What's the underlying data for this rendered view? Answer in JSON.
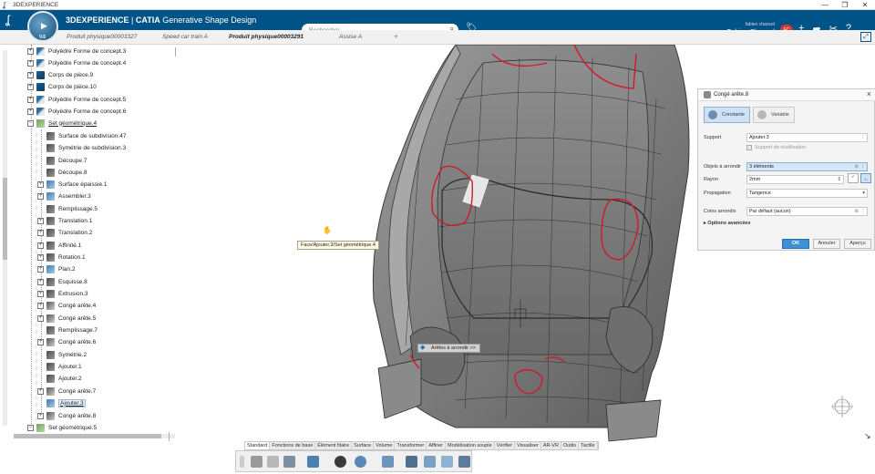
{
  "window": {
    "title": "3DEXPERIENCE",
    "controls": [
      "—",
      "❐",
      "✕"
    ]
  },
  "header": {
    "brand_bold": "3DEXPERIENCE",
    "brand_sep": " | ",
    "brand_app": "CATIA",
    "brand_module": " Generative Shape Design",
    "search_placeholder": "Rechercher",
    "user_small": "fabien chancel",
    "user_name": "Fabien Chancel",
    "avatar": "FC",
    "compass_version": "V.6"
  },
  "tabs": [
    {
      "label": "Produit physique00003327",
      "active": false
    },
    {
      "label": "Speed car train A",
      "active": false
    },
    {
      "label": "Produit physique00003291",
      "active": true
    },
    {
      "label": "Assise A",
      "active": false
    }
  ],
  "tree": {
    "items": [
      {
        "label": "Polyèdre Forme de concept.3",
        "y": 0
      },
      {
        "label": "Polyèdre Forme de concept.4"
      },
      {
        "label": "Corps de pièce.9"
      },
      {
        "label": "Corps de pièce.10"
      },
      {
        "label": "Polyèdre Forme de concept.5"
      },
      {
        "label": "Polyèdre Forme de concept.6"
      },
      {
        "label": "Set géométrique.4"
      },
      {
        "label": "Surface de subdivision.47"
      },
      {
        "label": "Symétrie de subdivision.3"
      },
      {
        "label": "Découpe.7"
      },
      {
        "label": "Découpe.8"
      },
      {
        "label": "Surface épaissie.1"
      },
      {
        "label": "Assembler.3"
      },
      {
        "label": "Remplissage.5"
      },
      {
        "label": "Translation.1"
      },
      {
        "label": "Translation.2"
      },
      {
        "label": "Affinité.1"
      },
      {
        "label": "Rotation.1"
      },
      {
        "label": "Plan.2"
      },
      {
        "label": "Esquisse.8"
      },
      {
        "label": "Extrusion.3"
      },
      {
        "label": "Congé arête.4"
      },
      {
        "label": "Congé arête.5"
      },
      {
        "label": "Remplissage.7"
      },
      {
        "label": "Congé arête.6"
      },
      {
        "label": "Symétrie.2"
      },
      {
        "label": "Ajouter.1"
      },
      {
        "label": "Ajouter.2"
      },
      {
        "label": "Congé arête.7"
      },
      {
        "label": "Ajouter.3"
      },
      {
        "label": "Congé arête.8"
      },
      {
        "label": "Set géométrique.5"
      }
    ]
  },
  "viewport": {
    "tooltip": "Face/Ajouter.3/Set géométrique.4",
    "edges_label": "Arêtes à arrondir >>"
  },
  "panel": {
    "title": "Congé arête.8",
    "mode_constant": "Constante",
    "mode_variable": "Variable",
    "support_label": "Support",
    "support_value": "Ajouter.3",
    "support_reuse": "Support de réutilisation",
    "objects_label": "Objets à arrondir",
    "objects_value": "3 éléments",
    "radius_label": "Rayon",
    "radius_value": "2mm",
    "propagation_label": "Propagation",
    "propagation_value": "Tangence",
    "corners_label": "Coins arrondis",
    "corners_value": "Par défaut (aucun)",
    "advanced": "Options avancées",
    "ok": "OK",
    "cancel": "Annuler",
    "preview": "Aperçu"
  },
  "toolbox": {
    "tabs": [
      "Standard",
      "Fonctions de base",
      "Élément filaire",
      "Surface",
      "Volume",
      "Transformer",
      "Affiner",
      "Modélisation souple",
      "Vérifier",
      "Visualiser",
      "AR-VR",
      "Outils",
      "Tactile"
    ],
    "active": "Standard"
  },
  "colors": {
    "topbar": "#005386",
    "accent_red": "#d01a2a",
    "model_gray": "#7a7a7a"
  }
}
